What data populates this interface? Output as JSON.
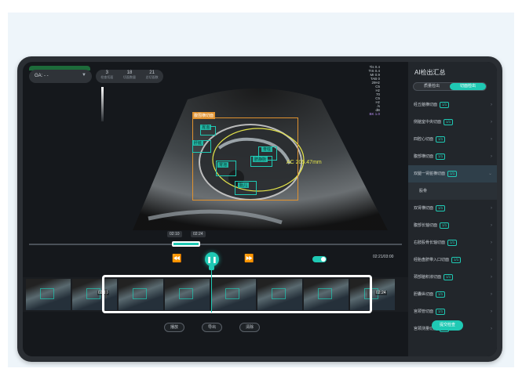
{
  "topbar": {
    "ga_label": "GA: - -",
    "counts": [
      {
        "value": "3",
        "label": "检查切面"
      },
      {
        "value": "18",
        "label": "切面数量"
      },
      {
        "value": "21",
        "label": "总切面数"
      }
    ]
  },
  "us_info": {
    "lines": [
      "Tis 0.4",
      "TIS 0.4",
      "MI 0.9",
      "TAB 0",
      "29Hz",
      "C5",
      "Hz",
      "70",
      "C5",
      "Hz",
      "/s",
      "dB"
    ],
    "highlight": "BK 1.0"
  },
  "annotations": {
    "main_label": "腹围横切面",
    "tags": [
      "胃泡",
      "脊柱",
      "肝脏",
      "脐静脉",
      "胃泡",
      "胎儿"
    ],
    "ac_text": "AC 205.47mm"
  },
  "playback": {
    "time_start": "02:10",
    "time_end": "02:24",
    "total": "02:21/03:00",
    "rewind_icon": "rewind-icon",
    "play_icon": "pause-icon",
    "forward_icon": "fast-forward-icon"
  },
  "filmstrip": {
    "frame_times": [
      "",
      "02:10",
      "",
      "",
      "",
      "",
      "",
      "02:24"
    ]
  },
  "actions": [
    "播放",
    "导出",
    "清除"
  ],
  "sidebar": {
    "title": "AI检出汇总",
    "segments": [
      "质量检出",
      "切面检出"
    ],
    "items": [
      {
        "label": "经丘脑横切面",
        "badge": "1/1"
      },
      {
        "label": "侧脑室中央切面",
        "badge": "1/1"
      },
      {
        "label": "四腔心切面",
        "badge": "1/1"
      },
      {
        "label": "腹部横切面",
        "badge": "1/1"
      },
      {
        "label": "双腿一肾脏横切面",
        "badge": "1/1",
        "active": true
      },
      {
        "label": "股骨",
        "badge": "",
        "sub": true
      },
      {
        "label": "双肾横切面",
        "badge": "1/1"
      },
      {
        "label": "腹部长轴切面",
        "badge": "1/1"
      },
      {
        "label": "右肢股骨长轴切面",
        "badge": "1/1"
      },
      {
        "label": "经胎盘脐带入口切面",
        "badge": "1/1"
      },
      {
        "label": "颈部脑积液切面",
        "badge": "1/1"
      },
      {
        "label": "胆囊纵切面",
        "badge": "1/1"
      },
      {
        "label": "宫颈管切面",
        "badge": "1/1"
      },
      {
        "label": "宫颈测量切面",
        "badge": "1/1"
      }
    ],
    "confirm_label": "提交检查"
  }
}
